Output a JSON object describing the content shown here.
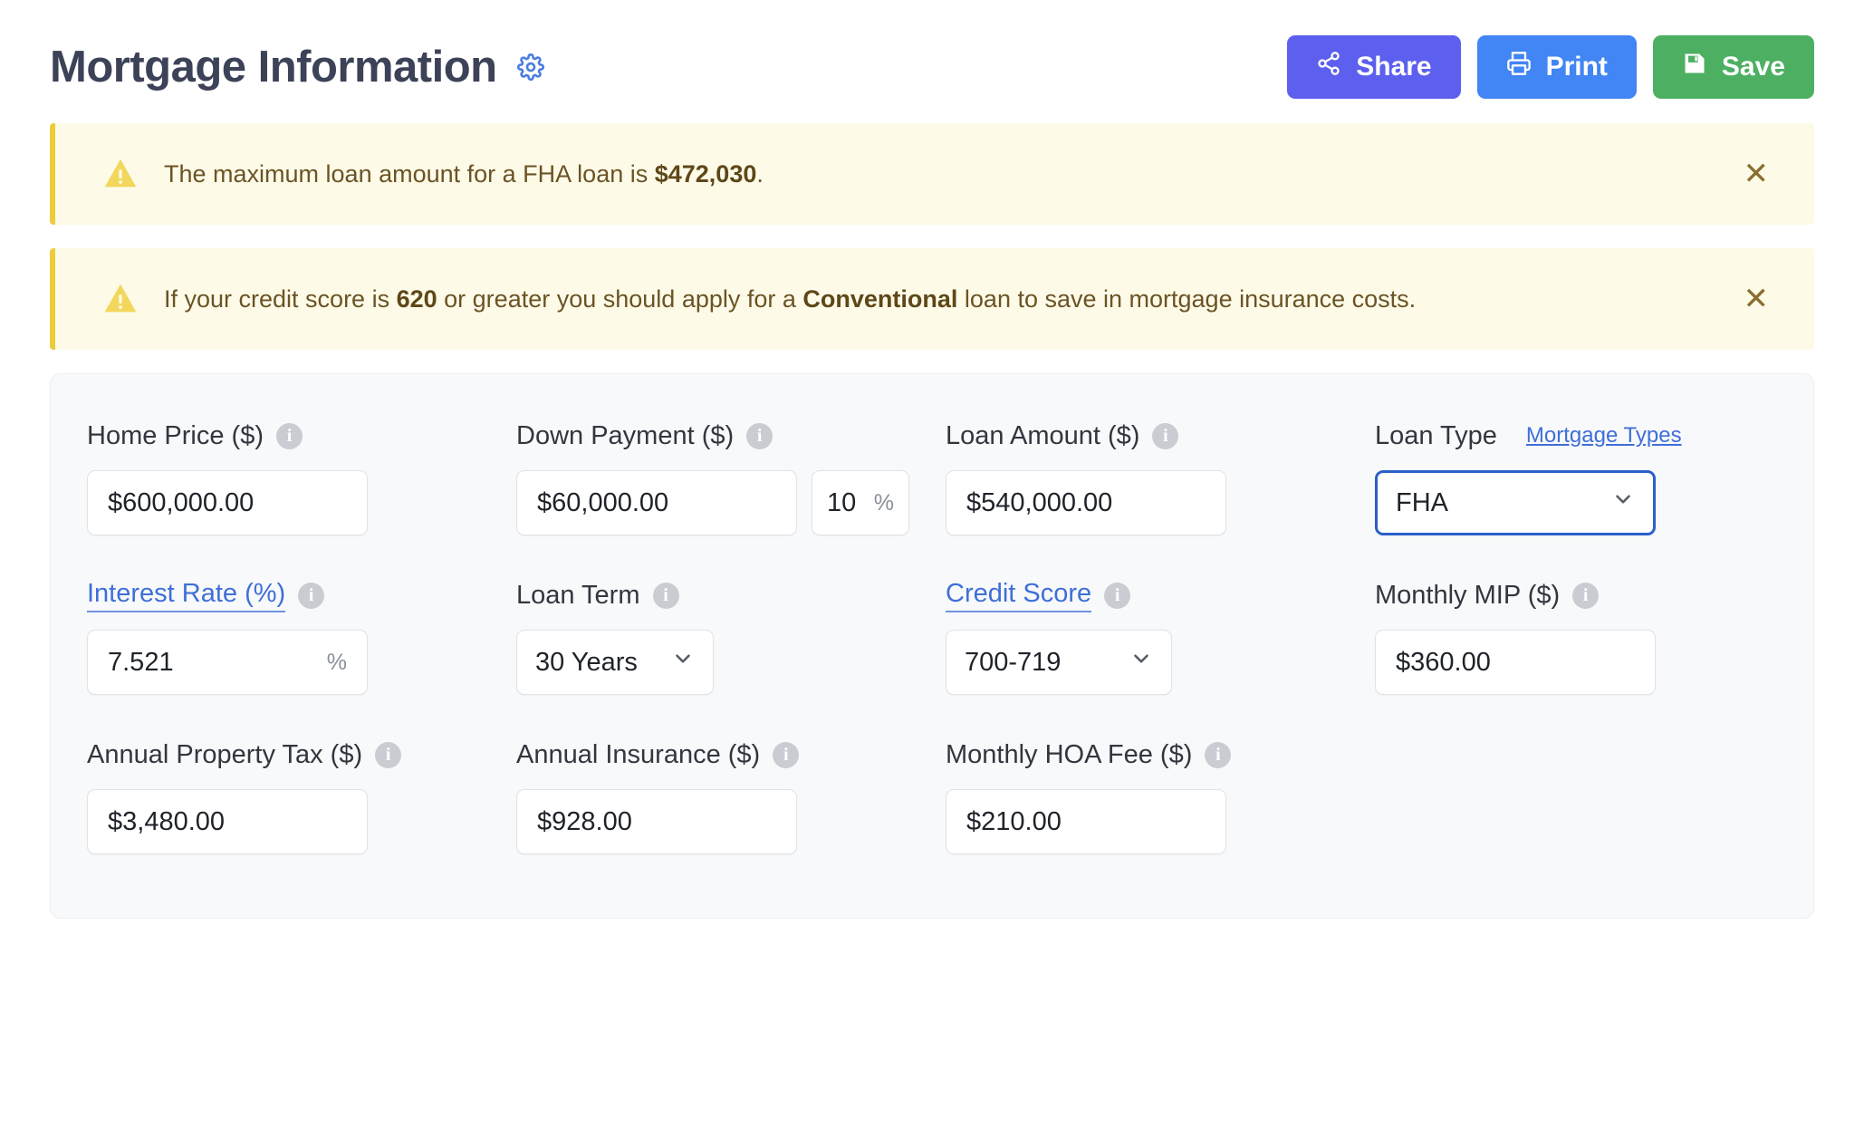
{
  "header": {
    "title": "Mortgage Information",
    "gear_icon": "gear-icon",
    "buttons": [
      {
        "label": "Share",
        "icon": "share-icon",
        "color": "#5d5fef"
      },
      {
        "label": "Print",
        "icon": "printer-icon",
        "color": "#4285f4"
      },
      {
        "label": "Save",
        "icon": "floppy-disk-icon",
        "color": "#4caf61"
      }
    ]
  },
  "alerts": [
    {
      "icon": "warning-triangle-icon",
      "text_before": "The maximum loan amount for a FHA loan is ",
      "text_bold": "$472,030",
      "text_after": ".",
      "close_label": "✕"
    },
    {
      "icon": "warning-triangle-icon",
      "text_before": "If your credit score is ",
      "text_bold": "620",
      "text_mid": " or greater you should apply for a ",
      "text_bold2": "Conventional",
      "text_after": " loan to save in mortgage insurance costs.",
      "close_label": "✕"
    }
  ],
  "form": {
    "home_price": {
      "label": "Home Price ($)",
      "value": "$600,000.00",
      "info": "info-icon"
    },
    "down_payment": {
      "label": "Down Payment ($)",
      "value": "$60,000.00",
      "percent_value": "10",
      "percent_suffix": "%",
      "info": "info-icon"
    },
    "loan_amount": {
      "label": "Loan Amount ($)",
      "value": "$540,000.00",
      "info": "info-icon"
    },
    "loan_type": {
      "label": "Loan Type",
      "side_link": "Mortgage Types",
      "value": "FHA",
      "chevron": "chevron-down-icon"
    },
    "interest_rate": {
      "label": "Interest Rate (%)",
      "value": "7.521",
      "suffix": "%",
      "info": "info-icon"
    },
    "loan_term": {
      "label": "Loan Term",
      "value": "30 Years",
      "chevron": "chevron-down-icon",
      "info": "info-icon"
    },
    "credit_score": {
      "label": "Credit Score",
      "value": "700-719",
      "chevron": "chevron-down-icon",
      "info": "info-icon"
    },
    "monthly_mip": {
      "label": "Monthly MIP ($)",
      "value": "$360.00",
      "info": "info-icon"
    },
    "property_tax": {
      "label": "Annual Property Tax ($)",
      "value": "$3,480.00",
      "info": "info-icon"
    },
    "insurance": {
      "label": "Annual Insurance ($)",
      "value": "$928.00",
      "info": "info-icon"
    },
    "hoa_fee": {
      "label": "Monthly HOA Fee ($)",
      "value": "$210.00",
      "info": "info-icon"
    }
  },
  "colors": {
    "accent_blue": "#3f6fd8",
    "share_purple": "#5d5fef",
    "print_blue": "#4285f4",
    "save_green": "#4caf61",
    "alert_bg": "#fdfbe8",
    "alert_border": "#eccc3d",
    "alert_text": "#6b5325",
    "panel_bg": "#f8f9fa",
    "title_color": "#3c4257"
  }
}
